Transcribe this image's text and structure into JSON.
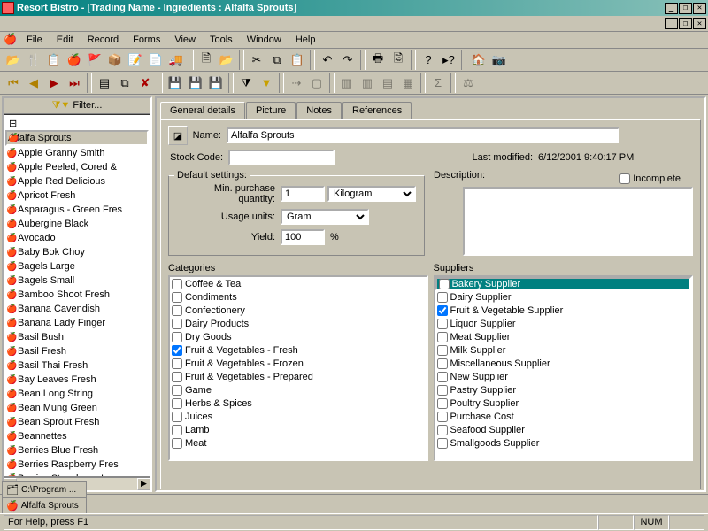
{
  "title": "Resort Bistro - [Trading Name - Ingredients : Alfalfa Sprouts]",
  "menu": [
    "File",
    "Edit",
    "Record",
    "Forms",
    "View",
    "Tools",
    "Window",
    "Help"
  ],
  "filter_label": "Filter...",
  "tree_root": "",
  "tree_items": [
    "Alfalfa Sprouts",
    "Apple Granny Smith",
    "Apple Peeled, Cored &",
    "Apple Red Delicious",
    "Apricot Fresh",
    "Asparagus - Green Fres",
    "Aubergine Black",
    "Avocado",
    "Baby Bok Choy",
    "Bagels Large",
    "Bagels Small",
    "Bamboo Shoot Fresh",
    "Banana Cavendish",
    "Banana Lady Finger",
    "Basil Bush",
    "Basil Fresh",
    "Basil Thai Fresh",
    "Bay Leaves Fresh",
    "Bean Long String",
    "Bean Mung Green",
    "Bean Sprout Fresh",
    "Beannettes",
    "Berries Blue Fresh",
    "Berries Raspberry Fres",
    "Berries Strawberry Lar"
  ],
  "tree_selected": 0,
  "tabs": [
    "General details",
    "Picture",
    "Notes",
    "References"
  ],
  "active_tab": 0,
  "fields": {
    "name_lbl": "Name:",
    "name_val": "Alfalfa Sprouts",
    "stock_lbl": "Stock Code:",
    "stock_val": "",
    "lastmod_lbl": "Last modified:",
    "lastmod_val": "6/12/2001 9:40:17 PM",
    "incomplete_lbl": "Incomplete",
    "incomplete_val": false,
    "desc_lbl": "Description:"
  },
  "defaults": {
    "legend": "Default settings:",
    "minqty_lbl": "Min. purchase quantity:",
    "minqty_val": "1",
    "minqty_unit": "Kilogram",
    "usage_lbl": "Usage units:",
    "usage_unit": "Gram",
    "yield_lbl": "Yield:",
    "yield_val": "100",
    "yield_suffix": "%"
  },
  "categories": {
    "label": "Categories",
    "items": [
      {
        "label": "Coffee & Tea",
        "checked": false
      },
      {
        "label": "Condiments",
        "checked": false
      },
      {
        "label": "Confectionery",
        "checked": false
      },
      {
        "label": "Dairy Products",
        "checked": false
      },
      {
        "label": "Dry Goods",
        "checked": false
      },
      {
        "label": "Fruit & Vegetables - Fresh",
        "checked": true
      },
      {
        "label": "Fruit & Vegetables - Frozen",
        "checked": false
      },
      {
        "label": "Fruit & Vegetables - Prepared",
        "checked": false
      },
      {
        "label": "Game",
        "checked": false
      },
      {
        "label": "Herbs & Spices",
        "checked": false
      },
      {
        "label": "Juices",
        "checked": false
      },
      {
        "label": "Lamb",
        "checked": false
      },
      {
        "label": "Meat",
        "checked": false
      }
    ]
  },
  "suppliers": {
    "label": "Suppliers",
    "items": [
      {
        "label": "Bakery Supplier",
        "checked": false,
        "selected": true
      },
      {
        "label": "Dairy Supplier",
        "checked": false
      },
      {
        "label": "Fruit & Vegetable Supplier",
        "checked": true
      },
      {
        "label": "Liquor Supplier",
        "checked": false
      },
      {
        "label": "Meat Supplier",
        "checked": false
      },
      {
        "label": "Milk Supplier",
        "checked": false
      },
      {
        "label": "Miscellaneous Supplier",
        "checked": false
      },
      {
        "label": "New Supplier",
        "checked": false
      },
      {
        "label": "Pastry Supplier",
        "checked": false
      },
      {
        "label": "Poultry Supplier",
        "checked": false
      },
      {
        "label": "Purchase Cost",
        "checked": false
      },
      {
        "label": "Seafood Supplier",
        "checked": false
      },
      {
        "label": "Smallgoods Supplier",
        "checked": false
      }
    ]
  },
  "docbar": [
    {
      "icon": "🗂",
      "label": "C:\\Program ..."
    },
    {
      "icon": "🍎",
      "label": "Alfalfa Sprouts"
    }
  ],
  "status": {
    "help": "For Help, press F1",
    "num": "NUM"
  }
}
